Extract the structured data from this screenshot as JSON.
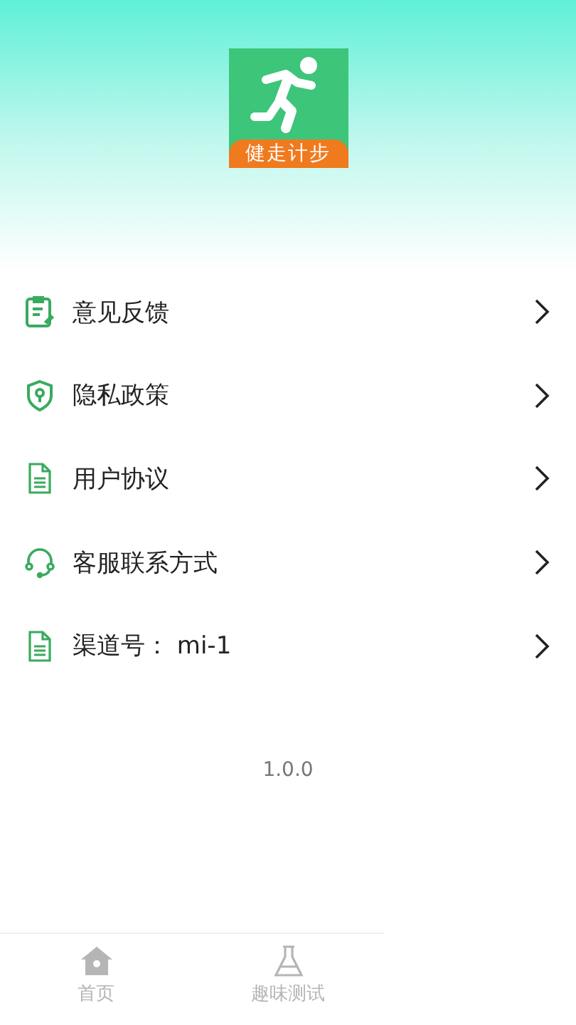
{
  "app": {
    "logo_text": "健走计步"
  },
  "menu": [
    {
      "kind": "feedback",
      "label": "意见反馈"
    },
    {
      "kind": "privacy",
      "label": "隐私政策"
    },
    {
      "kind": "document",
      "label": "用户协议"
    },
    {
      "kind": "support",
      "label": "客服联系方式"
    },
    {
      "kind": "document",
      "label": "渠道号： mi-1"
    }
  ],
  "version": "1.0.0",
  "tabs": [
    {
      "kind": "home",
      "label": "首页",
      "selected": false
    },
    {
      "kind": "test",
      "label": "趣味测试",
      "selected": false
    }
  ]
}
